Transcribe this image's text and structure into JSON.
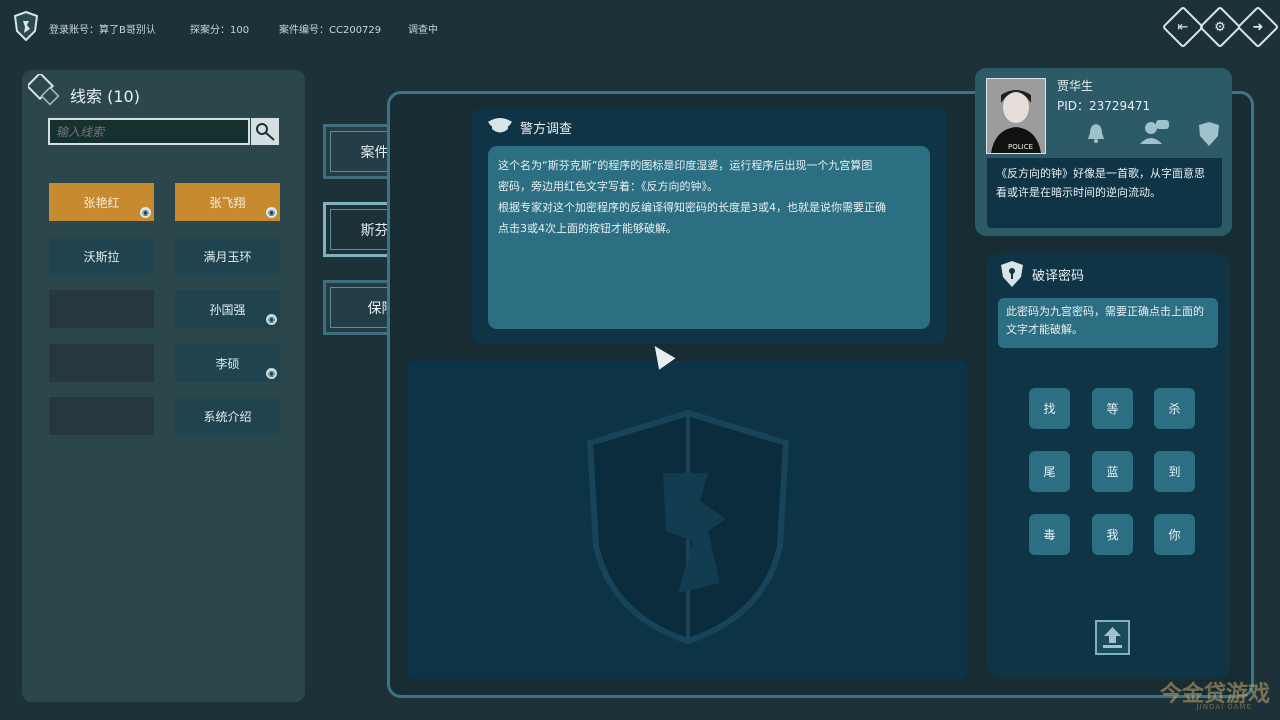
{
  "topbar": {
    "account": "登录账号：算了B哥别认",
    "score": "探案分：100",
    "case_no": "案件编号：CC200729",
    "status": "调查中",
    "icons": [
      "exit-icon",
      "settings-icon",
      "next-icon"
    ]
  },
  "clues": {
    "title": "线索 (10)",
    "search_placeholder": "输入线索",
    "items": [
      {
        "label": "张艳红",
        "style": "orange",
        "has_eye": true
      },
      {
        "label": "张飞翔",
        "style": "orange",
        "has_eye": true
      },
      {
        "label": "沃斯拉",
        "style": "normal",
        "has_eye": false
      },
      {
        "label": "满月玉环",
        "style": "normal",
        "has_eye": false
      },
      {
        "label": "",
        "style": "empty",
        "has_eye": false
      },
      {
        "label": "孙国强",
        "style": "normal",
        "has_eye": true
      },
      {
        "label": "",
        "style": "empty",
        "has_eye": false
      },
      {
        "label": "李硕",
        "style": "normal",
        "has_eye": true
      },
      {
        "label": "",
        "style": "empty",
        "has_eye": false
      },
      {
        "label": "系统介绍",
        "style": "normal",
        "has_eye": false
      }
    ]
  },
  "tabs": [
    {
      "label": "案件描述",
      "active": false
    },
    {
      "label": "斯芬克斯",
      "active": true
    },
    {
      "label": "保险箱",
      "active": false
    }
  ],
  "police": {
    "title": "警方调查",
    "line1": "这个名为“斯芬克斯”的程序的图标是印度湿婆，运行程序后出现一个九宫算图",
    "line2": "密码，旁边用红色文字写着：《反方向的钟》。",
    "line3": "根据专家对这个加密程序的反编译得知密码的长度是3或4，也就是说你需要正确",
    "line4": "点击3或4次上面的按钮才能够破解。"
  },
  "profile": {
    "name": "贾华生",
    "pid": "PID：23729471",
    "badge": "POLICE",
    "message": "《反方向的钟》好像是一首歌，从字面意思看或许是在暗示时间的逆向流动。"
  },
  "decode": {
    "title": "破译密码",
    "hint": "此密码为九宫密码，需要正确点击上面的文字才能破解。",
    "keys": [
      "找",
      "等",
      "杀",
      "尾",
      "蓝",
      "到",
      "毒",
      "我",
      "你"
    ]
  },
  "watermark": {
    "main": "今金贷游戏",
    "sub": "JINDAI GAME"
  },
  "colors": {
    "accent": "#c78a2f",
    "panel": "#0f3446",
    "highlight": "#2c6f82"
  }
}
